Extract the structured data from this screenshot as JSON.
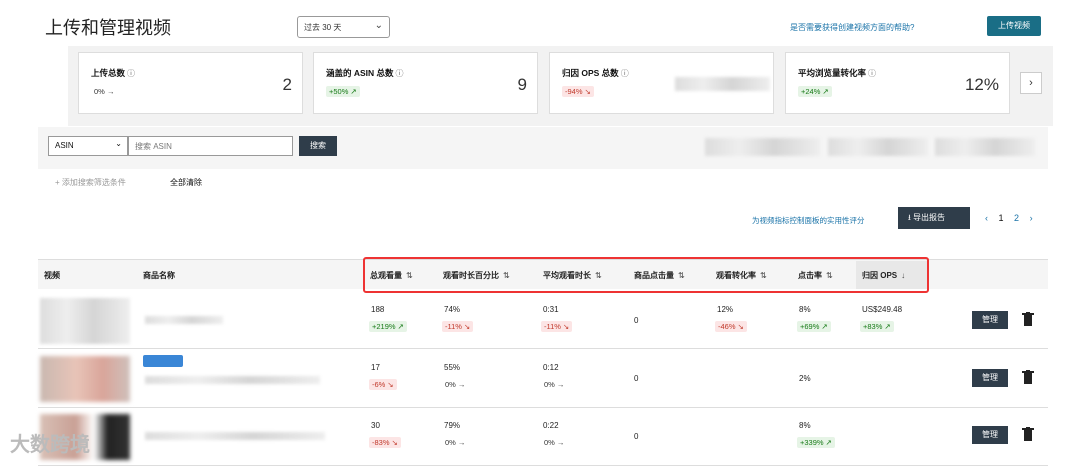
{
  "page": {
    "title": "上传和管理视频",
    "date_range": "过去 30 天",
    "help_link": "是否需要获得创建视频方面的帮助?",
    "upload_button": "上传视频"
  },
  "metrics": [
    {
      "label": "上传总数",
      "value": "2",
      "change": "0%",
      "trend": "flat"
    },
    {
      "label": "涵盖的 ASIN 总数",
      "value": "9",
      "change": "+50%",
      "trend": "up"
    },
    {
      "label": "归因 OPS 总数",
      "value": "",
      "change": "-94%",
      "trend": "down"
    },
    {
      "label": "平均浏览量转化率",
      "value": "12%",
      "change": "+24%",
      "trend": "up"
    }
  ],
  "filters": {
    "asin_select": "ASIN",
    "search_placeholder": "搜索 ASIN",
    "search_button": "搜索",
    "add_filter": "+ 添加搜索筛选条件",
    "clear_all": "全部清除"
  },
  "toolbar": {
    "util_link": "为视频指标控制面板的实用性评分",
    "export_button": "导出报告",
    "pages": [
      "1",
      "2"
    ]
  },
  "table": {
    "headers": {
      "video": "视频",
      "product": "商品名称",
      "total_views": "总观看量",
      "watch_pct": "观看时长百分比",
      "avg_watch": "平均观看时长",
      "clicks": "商品点击量",
      "view_conv": "观看转化率",
      "ctr": "点击率",
      "ops": "归因 OPS"
    },
    "rows": [
      {
        "views": "188",
        "views_chg": "+219%",
        "watch_pct": "74%",
        "watch_pct_chg": "-11%",
        "avg": "0:31",
        "avg_chg": "-11%",
        "clicks": "0",
        "conv": "12%",
        "conv_chg": "-46%",
        "ctr": "8%",
        "ctr_chg": "+69%",
        "ops": "US$249.48",
        "ops_chg": "+83%",
        "manage": "管理"
      },
      {
        "views": "17",
        "views_chg": "-6%",
        "watch_pct": "55%",
        "watch_pct_chg": "0%",
        "avg": "0:12",
        "avg_chg": "0%",
        "clicks": "0",
        "conv": "",
        "conv_chg": "",
        "ctr": "2%",
        "ctr_chg": "",
        "ops": "",
        "ops_chg": "",
        "manage": "管理"
      },
      {
        "views": "30",
        "views_chg": "-83%",
        "watch_pct": "79%",
        "watch_pct_chg": "0%",
        "avg": "0:22",
        "avg_chg": "0%",
        "clicks": "0",
        "conv": "",
        "conv_chg": "",
        "ctr": "8%",
        "ctr_chg": "+339%",
        "ops": "",
        "ops_chg": "",
        "manage": "管理"
      }
    ]
  },
  "watermark": "大数跨境"
}
